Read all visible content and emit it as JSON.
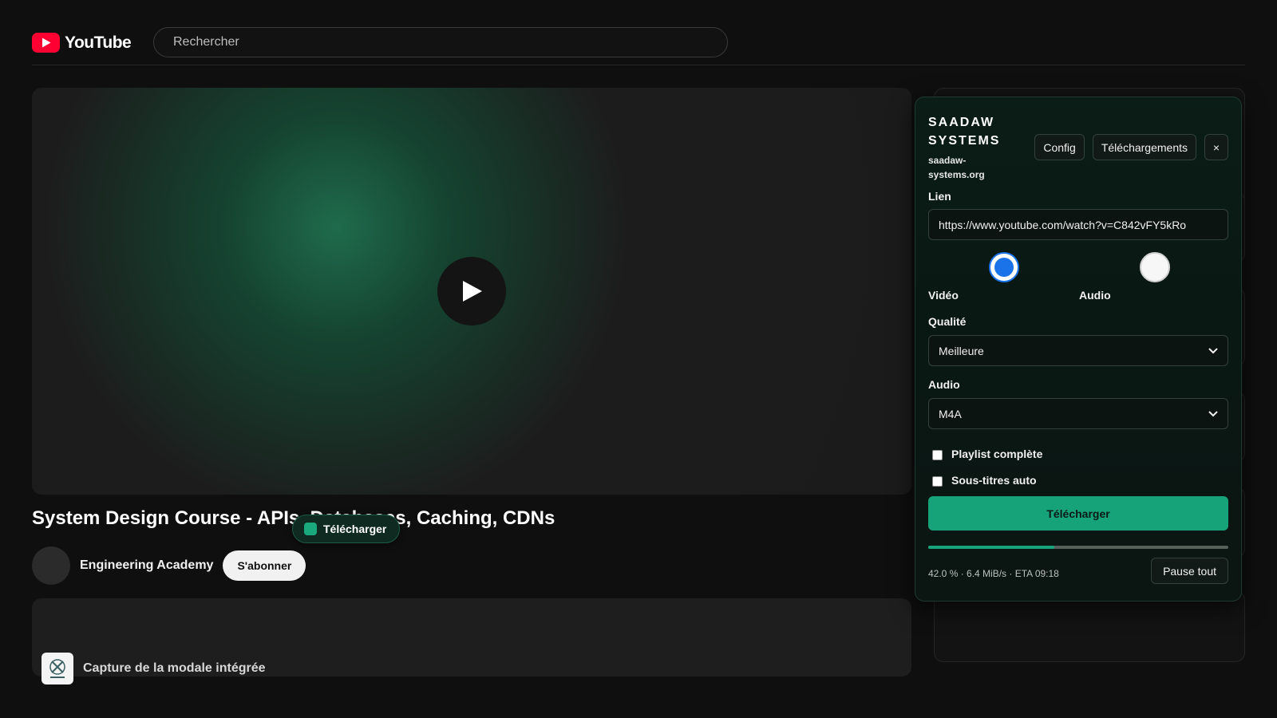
{
  "header": {
    "logo_text": "YouTube",
    "search_placeholder": "Rechercher"
  },
  "video": {
    "title": "System Design Course - APIs, Databases, Caching, CDNs",
    "channel": "Engineering Academy",
    "subscribe_label": "S'abonner"
  },
  "floating_download": {
    "label": "Télécharger"
  },
  "capture": {
    "label": "Capture de la modale intégrée"
  },
  "modal": {
    "brand_name": "SAADAW SYSTEMS",
    "brand_site": "saadaw-systems.org",
    "config_label": "Config",
    "downloads_label": "Téléchargements",
    "close_label": "×",
    "link_label": "Lien",
    "link_value": "https://www.youtube.com/watch?v=C842vFY5kRo",
    "mode_options": [
      {
        "label": "Vidéo",
        "selected": true
      },
      {
        "label": "Audio",
        "selected": false
      }
    ],
    "quality_label": "Qualité",
    "quality_value": "Meilleure",
    "audio_label": "Audio",
    "audio_value": "M4A",
    "playlist_label": "Playlist complète",
    "playlist_checked": false,
    "subtitles_label": "Sous-titres auto",
    "subtitles_checked": false,
    "download_label": "Télécharger",
    "progress_fraction": 0.42,
    "status_text": "42.0 % · 6.4 MiB/s · ETA 09:18",
    "pause_label": "Pause tout"
  },
  "colors": {
    "youtube_red": "#ff0033",
    "accent_green": "#17a37a",
    "radio_blue": "#1a73e8"
  }
}
